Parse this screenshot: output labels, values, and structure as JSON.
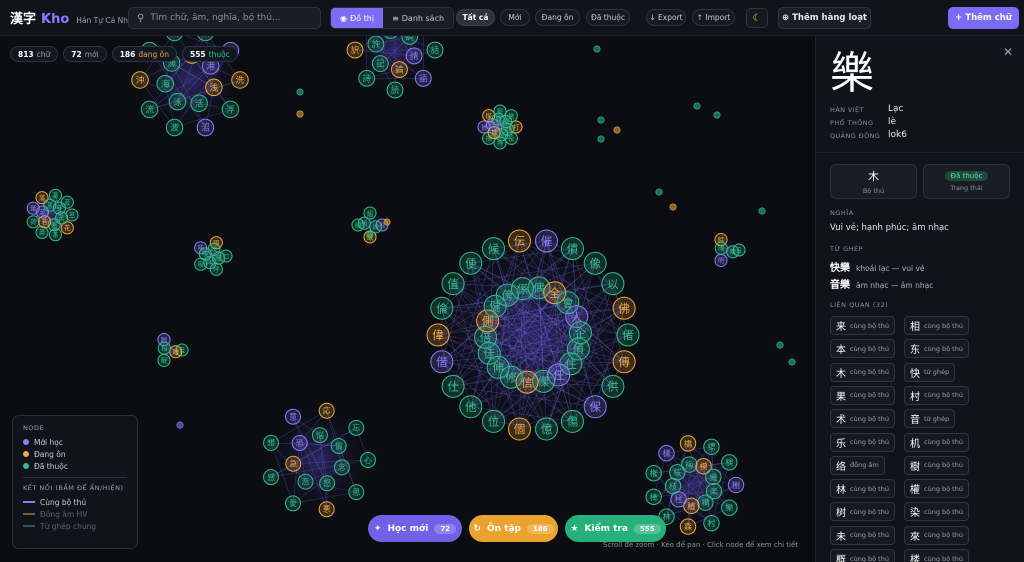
{
  "header": {
    "logo_cjk": "漢字",
    "logo_word": "Kho",
    "logo_sub": "Hán Tự Cá Nhân",
    "search_placeholder": "Tìm chữ, âm, nghĩa, bộ thủ...",
    "view_graph": "Đồ thị",
    "view_list": "Danh sách",
    "filters": [
      "Tất cả",
      "Mới",
      "Đang ôn",
      "Đã thuộc"
    ],
    "active_filter": "Tất cả",
    "export_label": "Export",
    "import_label": "Import",
    "bulk_add_label": "Thêm hàng loạt",
    "add_label": "Thêm chữ"
  },
  "stats": {
    "total_num": "813",
    "total_label": "chữ",
    "new_num": "72",
    "new_label": "mới",
    "review_num": "186",
    "review_label": "đang ôn",
    "known_num": "555",
    "known_label": "thuộc"
  },
  "legend": {
    "node_title": "NODE",
    "node_items": [
      {
        "label": "Mới học",
        "color": "#8b7cff"
      },
      {
        "label": "Đang ôn",
        "color": "#f0a83a"
      },
      {
        "label": "Đã thuộc",
        "color": "#2fbf86"
      }
    ],
    "edge_title": "KẾT NỐI (BẤM ĐỂ ẨN/HIỆN)",
    "edge_items": [
      {
        "label": "Cùng bộ thủ",
        "color": "#8b7cff",
        "active": true
      },
      {
        "label": "Đồng âm HV",
        "color": "#6b6340",
        "active": false
      },
      {
        "label": "Từ ghép chung",
        "color": "#2c5a48",
        "active": false
      }
    ]
  },
  "actions": {
    "learn_label": "Học mới",
    "learn_count": "72",
    "review_label": "Ôn tập",
    "review_count": "186",
    "test_label": "Kiểm tra",
    "test_count": "555",
    "hint": "Scroll để zoom · Kéo để pan · Click node để xem chi tiết"
  },
  "graph_clusters": [
    {
      "chars": [
        "偖",
        "傳",
        "供",
        "保",
        "傷",
        "億",
        "個",
        "位",
        "他",
        "仕",
        "借",
        "偉",
        "倫",
        "值",
        "便",
        "候",
        "伝",
        "催",
        "債",
        "像",
        "以",
        "佛",
        "偵",
        "住",
        "任",
        "傑",
        "信",
        "修",
        "伸",
        "佳",
        "倍",
        "側",
        "健",
        "傍",
        "係",
        "偶",
        "全",
        "會",
        "人",
        "企"
      ]
    },
    {
      "chars": [
        "洗",
        "浮",
        "沼",
        "波",
        "流",
        "沖",
        "酒",
        "湖",
        "渡",
        "游",
        "浅",
        "活",
        "泳",
        "海",
        "漁",
        "滞",
        "港"
      ]
    },
    {
      "chars": [
        "話",
        "語",
        "読",
        "詩",
        "訳",
        "誌",
        "説",
        "誇",
        "請",
        "論",
        "記",
        "許",
        "謝",
        "調"
      ]
    },
    {
      "chars": [
        "樹",
        "樂",
        "村",
        "森",
        "林",
        "棒",
        "権",
        "様",
        "橋",
        "標",
        "検",
        "楽",
        "構",
        "植",
        "柱",
        "枝",
        "桜",
        "梅",
        "模",
        "機"
      ]
    },
    {
      "chars": [
        "心",
        "思",
        "悪",
        "愛",
        "感",
        "想",
        "意",
        "応",
        "忘",
        "念",
        "怒",
        "恋",
        "急",
        "恐",
        "悩",
        "慣"
      ]
    },
    {
      "chars": [
        "草",
        "花",
        "茶",
        "英",
        "荷",
        "葉",
        "落",
        "薬",
        "芸",
        "苦",
        "著",
        "若",
        "菜",
        "蒸",
        "芽"
      ]
    },
    {
      "chars": [
        "打",
        "投",
        "持",
        "指",
        "拾",
        "探",
        "授",
        "捨",
        "掛",
        "接",
        "推",
        "提",
        "換",
        "撮"
      ]
    },
    {
      "chars": [
        "口",
        "呼",
        "吸",
        "味",
        "唱",
        "嘆",
        "叫",
        "喫",
        "吹"
      ]
    },
    {
      "chars": [
        "目",
        "眠",
        "眼",
        "睡",
        "相"
      ]
    },
    {
      "chars": [
        "日",
        "明",
        "時",
        "晴",
        "暗"
      ]
    },
    {
      "chars": [
        "糸",
        "紙",
        "細",
        "組",
        "練",
        "級"
      ]
    }
  ],
  "detail": {
    "char": "樂",
    "hanviet_label": "HÁN VIỆT",
    "hanviet": "Lạc",
    "pinyin_label": "PHỔ THÔNG",
    "pinyin": "lè",
    "canto_label": "QUẢNG ĐÔNG",
    "canto": "lok6",
    "radical": "木",
    "radical_label": "Bộ thủ",
    "status": "Đã thuộc",
    "status_label": "Trạng thái",
    "meaning_title": "NGHĨA",
    "meaning": "Vui vẻ; hạnh phúc; âm nhạc",
    "compound_title": "TỪ GHÉP",
    "compounds": [
      {
        "word": "快樂",
        "meaning": "khoái lạc — vui vẻ"
      },
      {
        "word": "音樂",
        "meaning": "âm nhạc — âm nhạc"
      }
    ],
    "related_title": "LIÊN QUAN (32)",
    "related": [
      {
        "ch": "来",
        "type": "cùng bộ thủ"
      },
      {
        "ch": "相",
        "type": "cùng bộ thủ"
      },
      {
        "ch": "本",
        "type": "cùng bộ thủ"
      },
      {
        "ch": "东",
        "type": "cùng bộ thủ"
      },
      {
        "ch": "木",
        "type": "cùng bộ thủ"
      },
      {
        "ch": "快",
        "type": "từ ghép"
      },
      {
        "ch": "果",
        "type": "cùng bộ thủ"
      },
      {
        "ch": "村",
        "type": "cùng bộ thủ"
      },
      {
        "ch": "术",
        "type": "cùng bộ thủ"
      },
      {
        "ch": "音",
        "type": "từ ghép"
      },
      {
        "ch": "乐",
        "type": "cùng bộ thủ"
      },
      {
        "ch": "机",
        "type": "cùng bộ thủ"
      },
      {
        "ch": "络",
        "type": "đồng âm"
      },
      {
        "ch": "樹",
        "type": "cùng bộ thủ"
      },
      {
        "ch": "林",
        "type": "cùng bộ thủ"
      },
      {
        "ch": "權",
        "type": "cùng bộ thủ"
      },
      {
        "ch": "树",
        "type": "cùng bộ thủ"
      },
      {
        "ch": "染",
        "type": "cùng bộ thủ"
      },
      {
        "ch": "未",
        "type": "cùng bộ thủ"
      },
      {
        "ch": "來",
        "type": "cùng bộ thủ"
      },
      {
        "ch": "概",
        "type": "cùng bộ thủ"
      },
      {
        "ch": "楼",
        "type": "cùng bộ thủ"
      }
    ]
  },
  "colors": {
    "new": "#8b7cff",
    "review": "#f0a83a",
    "known": "#2fbf86",
    "accent": "#7b6cf6"
  }
}
